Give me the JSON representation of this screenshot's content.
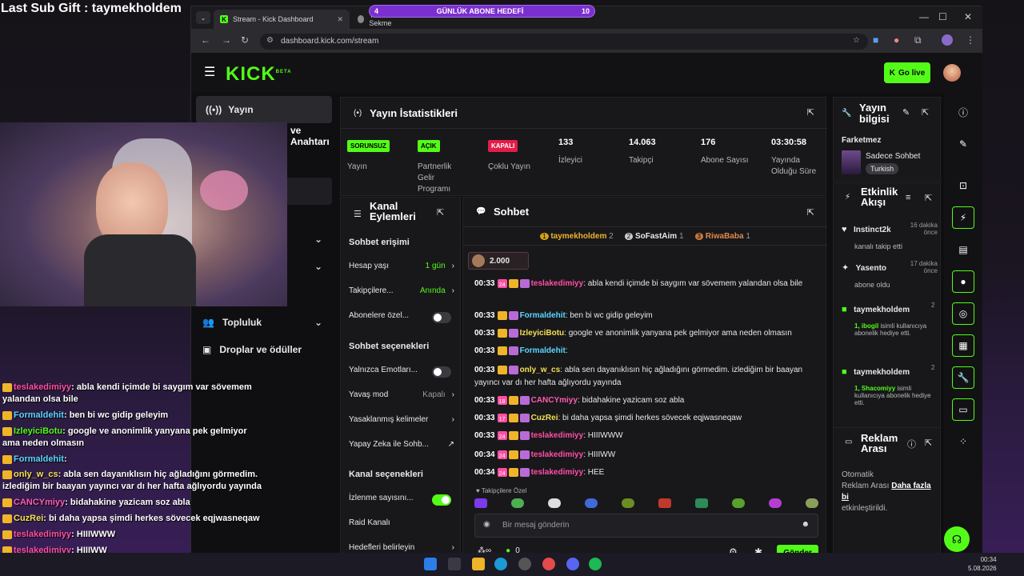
{
  "overlay": {
    "sub_gift": "Last Sub Gift : taymekholdem",
    "goal": {
      "left": "4",
      "label": "GÜNLÜK ABONE HEDEFİ",
      "right": "10",
      "progress_fraction": 0.4
    },
    "hidden_text": "ve Anahtarı",
    "chat": [
      {
        "user": "teslakedimiyy",
        "text": "abla kendi içimde bi saygım var sövemem yalandan olsa bile",
        "color": "#ff4fa3"
      },
      {
        "user": "Formaldehit",
        "text": "ben bi wc gidip geleyim",
        "color": "#5ad6ff"
      },
      {
        "user": "IzleyiciBotu",
        "text": "google ve anonimlik yanyana pek gelmiyor ama neden olmasın",
        "color": "#53fc18"
      },
      {
        "user": "Formaldehit",
        "text": "",
        "color": "#5ad6ff"
      },
      {
        "user": "only_w_cs",
        "text": "abla sen dayanıklısın hiç ağladığını görmedim. izlediğim bir baayan yayıncı var dı her hafta ağlıyordu yayında",
        "color": "#f5e050"
      },
      {
        "user": "CANCYmiyy",
        "text": "bidahakine yazicam soz abla",
        "color": "#ff5cb0"
      },
      {
        "user": "CuzRei",
        "text": "bi daha yapsa şimdi herkes sövecek eqjwasneqaw",
        "color": "#f5e050"
      },
      {
        "user": "teslakedimiyy",
        "text": "HIIIWWW",
        "color": "#ff4fa3"
      },
      {
        "user": "teslakedimiyy",
        "text": "HIIIWW",
        "color": "#ff4fa3"
      },
      {
        "user": "teslakedimiyy",
        "text": "HEE",
        "color": "#ff4fa3"
      }
    ]
  },
  "browser": {
    "tabs": [
      {
        "label": "Stream - Kick Dashboard"
      },
      {
        "label": "Yeni Sekme"
      }
    ],
    "url": "dashboard.kick.com/stream"
  },
  "kick": {
    "logo": "KICK",
    "logo_beta": "BETA",
    "go_live": "Go live",
    "sidebar": {
      "active": "Yayın",
      "items": [
        {
          "label": "Topluluk"
        },
        {
          "label": "Droplar ve ödüller"
        }
      ]
    },
    "stats": {
      "title": "Yayın İstatistikleri",
      "cells": [
        {
          "badge": "SORUNSUZ",
          "label": "Yayın"
        },
        {
          "badge": "AÇIK",
          "label": "Partnerlik Gelir Programı"
        },
        {
          "badge": "KAPALI",
          "label": "Çoklu Yayın"
        },
        {
          "num": "133",
          "label": "İzleyici"
        },
        {
          "num": "14.063",
          "label": "Takipçi"
        },
        {
          "num": "176",
          "label": "Abone Sayısı"
        },
        {
          "num": "03:30:58",
          "label": "Yayında Olduğu Süre"
        }
      ]
    },
    "stream_info": {
      "title": "Yayın bilgisi",
      "game": "Farketmez",
      "stream_title": "Sadece Sohbet",
      "language": "Turkish"
    },
    "channel_actions": {
      "title": "Kanal Eylemleri",
      "chat_access": "Sohbet erişimi",
      "account_age": "Hesap yaşı",
      "account_age_val": "1 gün",
      "followers": "Takipçilere...",
      "followers_val": "Anında",
      "subs_only": "Abonelere özel...",
      "chat_options": "Sohbet seçenekleri",
      "emotes_only": "Yalnızca Emotları...",
      "slow_mode": "Yavaş mod",
      "slow_mode_val": "Kapalı",
      "banned_words": "Yasaklanmış kelimeler",
      "ai_chat": "Yapay Zeka ile Sohb...",
      "channel_options": "Kanal seçenekleri",
      "view_count": "İzlenme sayısını...",
      "raid": "Raid Kanalı",
      "goals": "Hedefleri belirleyin"
    },
    "chat": {
      "title": "Sohbet",
      "top": [
        {
          "rank": "1",
          "name": "taymekholdem",
          "count": "2"
        },
        {
          "rank": "2",
          "name": "SoFastAim",
          "count": "1"
        },
        {
          "rank": "3",
          "name": "RiwaBaba",
          "count": "1"
        }
      ],
      "pinned_amount": "2.000",
      "messages": [
        {
          "time": "00:33",
          "user": "teslakedimiyy",
          "text": "abla kendi içimde bi saygım var sövemem yalandan olsa bile",
          "color": "#ff4fa3",
          "badge": "24"
        },
        {
          "time": "00:33",
          "user": "Formaldehit",
          "text": "ben bi wc gidip geleyim",
          "color": "#5ad6ff"
        },
        {
          "time": "00:33",
          "user": "IzleyiciBotu",
          "text": "google ve anonimlik yanyana pek gelmiyor ama neden olmasın",
          "color": "#f5e050"
        },
        {
          "time": "00:33",
          "user": "Formaldehit",
          "text": "",
          "color": "#5ad6ff"
        },
        {
          "time": "00:33",
          "user": "only_w_cs",
          "text": "abla sen dayanıklısın hiç ağladığını görmedim. izlediğim bir baayan yayıncı var dı her hafta ağlıyordu yayında",
          "color": "#f5e050"
        },
        {
          "time": "00:33",
          "user": "CANCYmiyy",
          "text": "bidahakine yazicam soz abla",
          "color": "#ff5cb0",
          "badge": "18"
        },
        {
          "time": "00:33",
          "user": "CuzRei",
          "text": "bi daha yapsa şimdi herkes sövecek eqjwasneqaw",
          "color": "#f5e050",
          "badge": "17"
        },
        {
          "time": "00:33",
          "user": "teslakedimiyy",
          "text": "HIIIWWW",
          "color": "#ff4fa3",
          "badge": "24"
        },
        {
          "time": "00:34",
          "user": "teslakedimiyy",
          "text": "HIIIWW",
          "color": "#ff4fa3",
          "badge": "24"
        },
        {
          "time": "00:34",
          "user": "teslakedimiyy",
          "text": "HEE",
          "color": "#ff4fa3",
          "badge": "24"
        }
      ],
      "emote_section": "Takipçilere Özel",
      "input_placeholder": "Bir mesaj gönderin",
      "points": "0",
      "send": "Gönder"
    },
    "activity": {
      "title": "Etkinlik Akışı",
      "items": [
        {
          "user": "Instinct2k",
          "time": "16 dakika önce",
          "desc": "kanalı takip etti"
        },
        {
          "user": "Yasento",
          "time": "17 dakika önce",
          "desc": "abone oldu"
        },
        {
          "user": "taymekholdem",
          "time": "2",
          "desc_user": "1, ibogil",
          "desc": " isimli kullanıcıya abonelik hediye etti."
        },
        {
          "user": "taymekholdem",
          "time": "2",
          "desc_user": "1, Shacomiyy",
          "desc": " isimli kullanıcıya abonelik hediye etti."
        }
      ]
    },
    "ads": {
      "title": "Reklam Arası",
      "line1": "Otomatik",
      "line2": "Reklam Arası",
      "line3": "etkinleştirildi.",
      "link": "Daha fazla bi"
    }
  },
  "taskbar": {
    "time": "00:34",
    "date": "5.08.2026"
  },
  "colors": {
    "accent": "#53fc18",
    "panel": "#18181b"
  }
}
